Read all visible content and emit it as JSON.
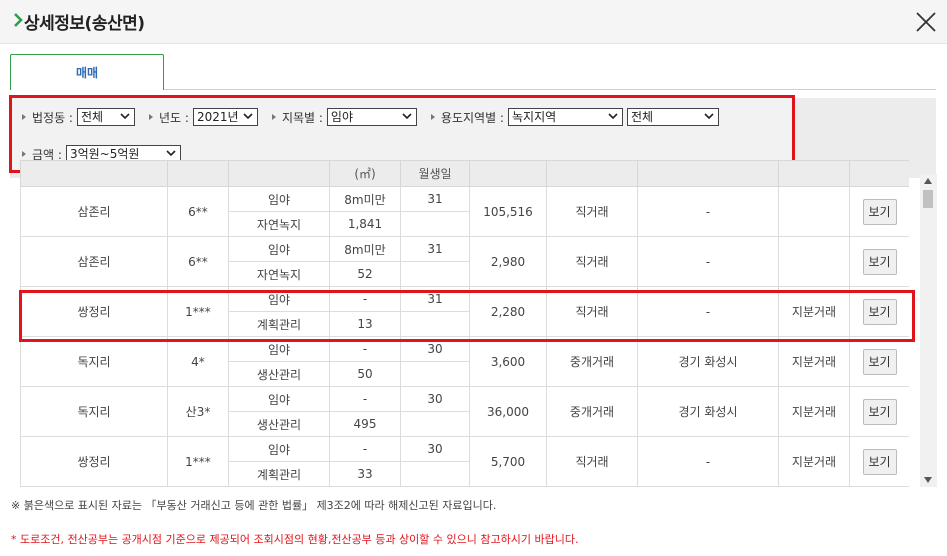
{
  "header": {
    "title": "상세정보(송산면)",
    "close_icon": "close-icon",
    "accent_color": "#2e9e48"
  },
  "tabs": [
    {
      "label": "매매"
    }
  ],
  "filters": {
    "bjd_label": "법정동 :",
    "bjd_value": "전체",
    "year_label": "년도 :",
    "year_value": "2021년",
    "jimok_label": "지목별 :",
    "jimok_value": "임야",
    "zone_label": "용도지역별 :",
    "zone_value": "녹지지역",
    "zone_sub_value": "전체",
    "amount_label": "금액 :",
    "amount_value": "3억원~5억원"
  },
  "table": {
    "headers": [
      "",
      "",
      "",
      "(㎡)",
      "월생일",
      "",
      "",
      "",
      "",
      ""
    ],
    "rows": [
      {
        "ri": "삼존리",
        "bunji": "6**",
        "jimok": "임야",
        "zone": "자연녹지",
        "area_a": "8m미만",
        "area_b": "1,841",
        "day": "31",
        "price": "105,516",
        "type": "직거래",
        "agent": "-",
        "share": "",
        "btn": "보기"
      },
      {
        "ri": "삼존리",
        "bunji": "6**",
        "jimok": "임야",
        "zone": "자연녹지",
        "area_a": "8m미만",
        "area_b": "52",
        "day": "31",
        "price": "2,980",
        "type": "직거래",
        "agent": "-",
        "share": "",
        "btn": "보기"
      },
      {
        "ri": "쌍정리",
        "bunji": "1***",
        "jimok": "임야",
        "zone": "계획관리",
        "area_a": "-",
        "area_b": "13",
        "day": "31",
        "price": "2,280",
        "type": "직거래",
        "agent": "-",
        "share": "지분거래",
        "btn": "보기"
      },
      {
        "ri": "독지리",
        "bunji": "4*",
        "jimok": "임야",
        "zone": "생산관리",
        "area_a": "-",
        "area_b": "50",
        "day": "30",
        "price": "3,600",
        "type": "중개거래",
        "agent": "경기 화성시",
        "share": "지분거래",
        "btn": "보기"
      },
      {
        "ri": "독지리",
        "bunji": "산3*",
        "jimok": "임야",
        "zone": "생산관리",
        "area_a": "-",
        "area_b": "495",
        "day": "30",
        "price": "36,000",
        "type": "중개거래",
        "agent": "경기 화성시",
        "share": "지분거래",
        "btn": "보기"
      },
      {
        "ri": "쌍정리",
        "bunji": "1***",
        "jimok": "임야",
        "zone": "계획관리",
        "area_a": "-",
        "area_b": "33",
        "day": "30",
        "price": "5,700",
        "type": "직거래",
        "agent": "-",
        "share": "지분거래",
        "btn": "보기"
      }
    ]
  },
  "notes": {
    "note1": "※ 붉은색으로 표시된 자료는 「부동산 거래신고 등에 관한 법률」 제3조2에 따라 해제신고된 자료입니다.",
    "note2": "* 도로조건, 전산공부는 공개시점 기준으로 제공되어 조회시점의 현황,전산공부 등과 상이할 수 있으니 참고하시기 바랍니다."
  },
  "colors": {
    "highlight": "#e0141c",
    "tab_text": "#2e6bb0"
  }
}
